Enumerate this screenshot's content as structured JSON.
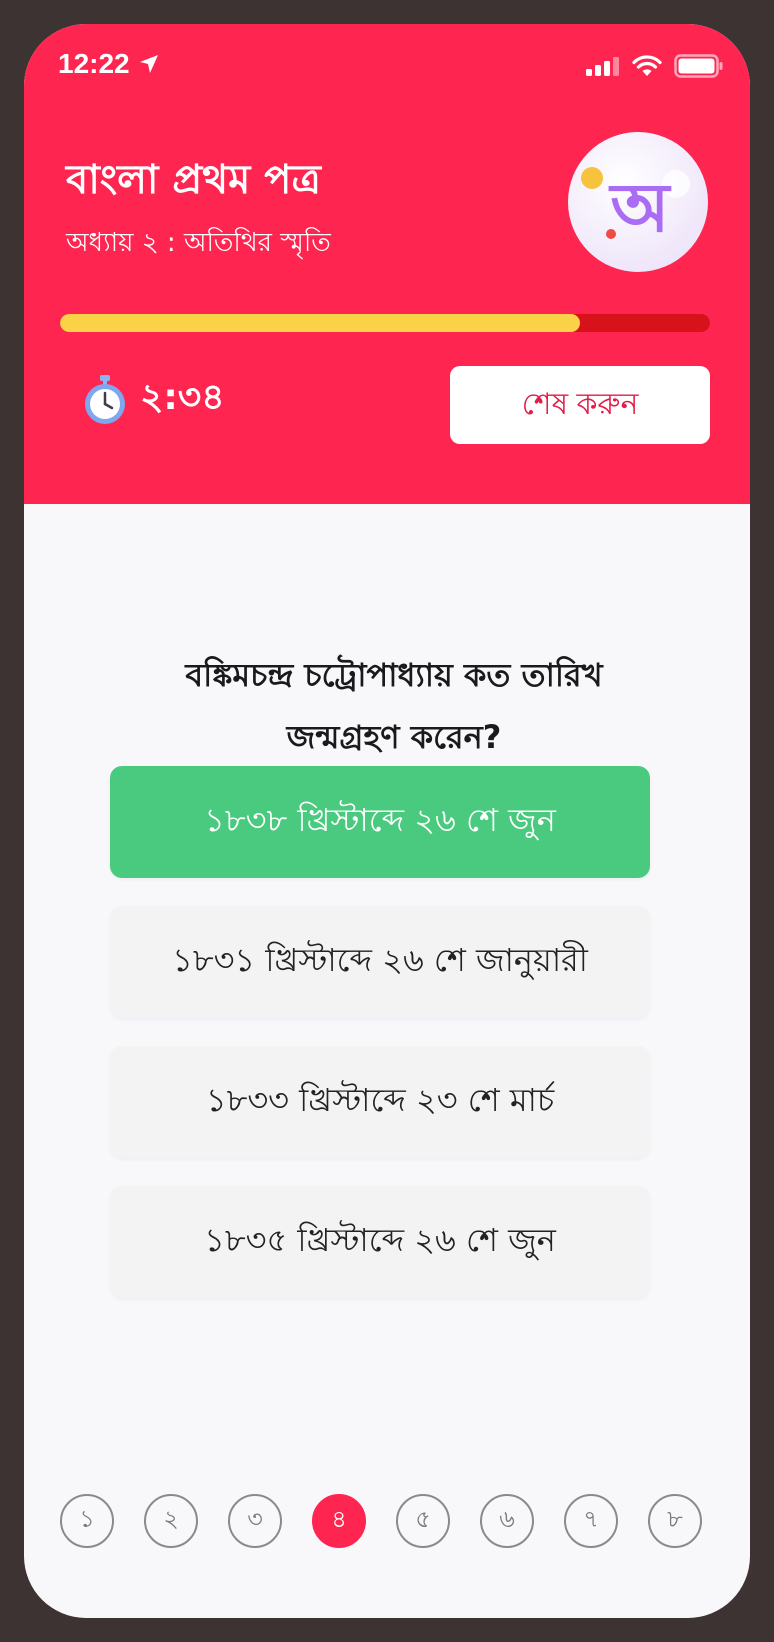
{
  "status": {
    "time": "12:22"
  },
  "header": {
    "title": "বাংলা প্রথম পত্র",
    "subtitle": "অধ্যায় ২ : অতিথির স্মৃতি",
    "avatar_glyph": "অ",
    "progress_fraction": 0.8,
    "timer": "২:৩৪",
    "finish_label": "শেষ করুন"
  },
  "question": {
    "text": "বঙ্কিমচন্দ্র চট্রোপাধ্যায় কত তারিখ জন্মগ্রহণ করেন?",
    "options": [
      "১৮৩৮ খ্রিস্টাব্দে ২৬ শে জুন",
      "১৮৩১ খ্রিস্টাব্দে ২৬ শে জানুয়ারী",
      "১৮৩৩ খ্রিস্টাব্দে ২৩ শে মার্চ",
      "১৮৩৫ খ্রিস্টাব্দে ২৬ শে জুন"
    ],
    "correct_index": 0
  },
  "pager": {
    "pages": [
      "১",
      "২",
      "৩",
      "৪",
      "৫",
      "৬",
      "৭",
      "৮"
    ],
    "current_index": 3
  },
  "colors": {
    "header": "#fe2650",
    "progress_fill": "#f9d247",
    "progress_track": "#d8121b",
    "correct": "#49ca7f"
  },
  "icons": {
    "location": "location-arrow-icon",
    "signal": "cellular-signal-icon",
    "wifi": "wifi-icon",
    "battery": "battery-icon",
    "timer": "stopwatch-icon"
  }
}
